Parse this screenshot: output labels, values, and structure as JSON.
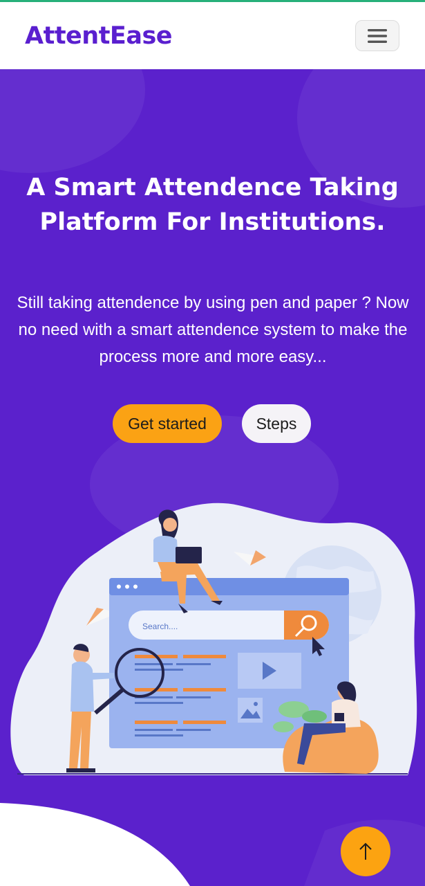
{
  "brand": {
    "name": "AttentEase"
  },
  "hero": {
    "title": "A Smart Attendence Taking Platform For Institutions.",
    "subtitle": "Still taking attendence by using pen and paper ? Now no need with a smart attendence system to make the process more and more easy...",
    "buttons": {
      "primary": "Get started",
      "secondary": "Steps"
    },
    "illustration": {
      "search_placeholder": "Search...."
    }
  },
  "icons": {
    "menu": "hamburger-menu-icon",
    "scroll_top": "arrow-up-icon"
  },
  "colors": {
    "brand": "#5a1fcf",
    "hero_bg": "#5b21cc",
    "accent": "#fba214",
    "top_bar": "#27b07a"
  }
}
